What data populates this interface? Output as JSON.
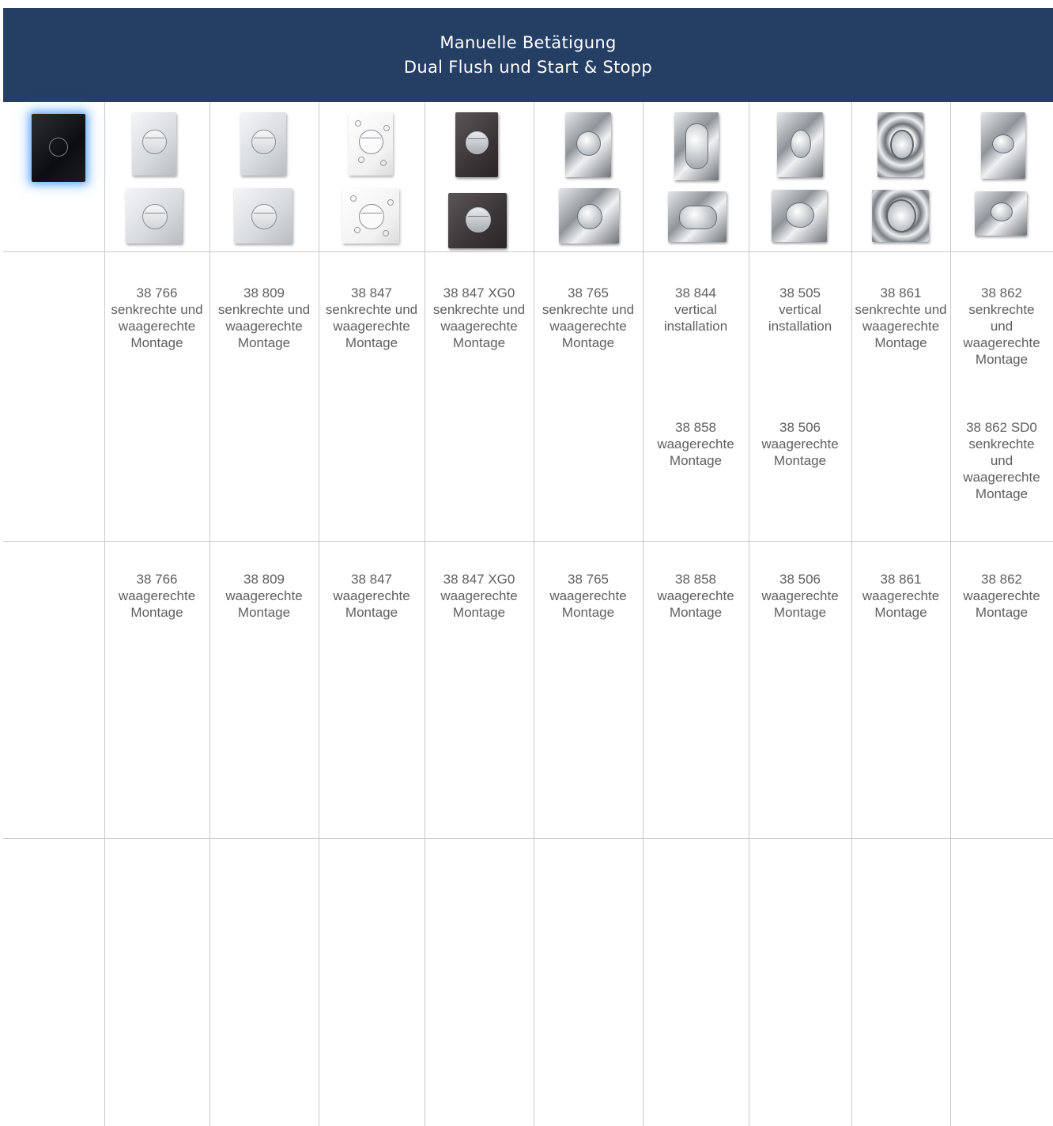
{
  "header": {
    "title_line1": "Manuelle Betätigung",
    "title_line2": "Dual Flush und Start & Stopp"
  },
  "colors": {
    "header_bg": "#253e63",
    "header_text": "#ffffff",
    "grid_line": "#c9c9c9",
    "body_text": "#5f5f5f"
  },
  "row1": [
    {
      "number": "38 766",
      "desc": [
        "senkrechte und",
        "waagerechte",
        "Montage"
      ]
    },
    {
      "number": "38 809",
      "desc": [
        "senkrechte und",
        "waagerechte",
        "Montage"
      ]
    },
    {
      "number": "38 847",
      "desc": [
        "senkrechte und",
        "waagerechte",
        "Montage"
      ]
    },
    {
      "number": "38 847 XG0",
      "desc": [
        "senkrechte und",
        "waagerechte",
        "Montage"
      ]
    },
    {
      "number": "38 765",
      "desc": [
        "senkrechte und",
        "waagerechte",
        "Montage"
      ]
    },
    {
      "number": "38 844",
      "desc": [
        "vertical",
        "installation"
      ]
    },
    {
      "number": "38 505",
      "desc": [
        "vertical",
        "installation"
      ]
    },
    {
      "number": "38 861",
      "desc": [
        "senkrechte und",
        "waagerechte",
        "Montage"
      ]
    },
    {
      "number": "38 862",
      "desc": [
        "senkrechte",
        "und",
        "waagerechte",
        "Montage"
      ]
    }
  ],
  "row1_extra": [
    {
      "col": 6,
      "number": "38 858",
      "desc": [
        "waagerechte",
        "Montage"
      ]
    },
    {
      "col": 7,
      "number": "38 506",
      "desc": [
        "waagerechte",
        "Montage"
      ]
    },
    {
      "col": 9,
      "number": "38 862 SD0",
      "desc": [
        "senkrechte",
        "und",
        "waagerechte",
        "Montage"
      ]
    }
  ],
  "row2": [
    {
      "number": "38 766",
      "desc": [
        "waagerechte",
        "Montage"
      ]
    },
    {
      "number": "38 809",
      "desc": [
        "waagerechte",
        "Montage"
      ]
    },
    {
      "number": "38 847",
      "desc": [
        "waagerechte",
        "Montage"
      ]
    },
    {
      "number": "38 847 XG0",
      "desc": [
        "waagerechte",
        "Montage"
      ]
    },
    {
      "number": "38 765",
      "desc": [
        "waagerechte",
        "Montage"
      ]
    },
    {
      "number": "38 858",
      "desc": [
        "waagerechte",
        "Montage"
      ]
    },
    {
      "number": "38 506",
      "desc": [
        "waagerechte",
        "Montage"
      ]
    },
    {
      "number": "38 861",
      "desc": [
        "waagerechte",
        "Montage"
      ]
    },
    {
      "number": "38 862",
      "desc": [
        "waagerechte",
        "Montage"
      ]
    }
  ],
  "plates": [
    {
      "col": 0,
      "style": "glow-black-icon"
    },
    {
      "col": 1,
      "style": "silver-round-icon"
    },
    {
      "col": 2,
      "style": "matte-silver-round-icon"
    },
    {
      "col": 3,
      "style": "white-decor-round-icon"
    },
    {
      "col": 4,
      "style": "dark-grey-round-icon"
    },
    {
      "col": 5,
      "style": "chrome-round-icon"
    },
    {
      "col": 6,
      "style": "chrome-pill-icon"
    },
    {
      "col": 7,
      "style": "chrome-oval-icon"
    },
    {
      "col": 8,
      "style": "chrome-wave-icon"
    },
    {
      "col": 9,
      "style": "chrome-small-round-icon"
    }
  ]
}
